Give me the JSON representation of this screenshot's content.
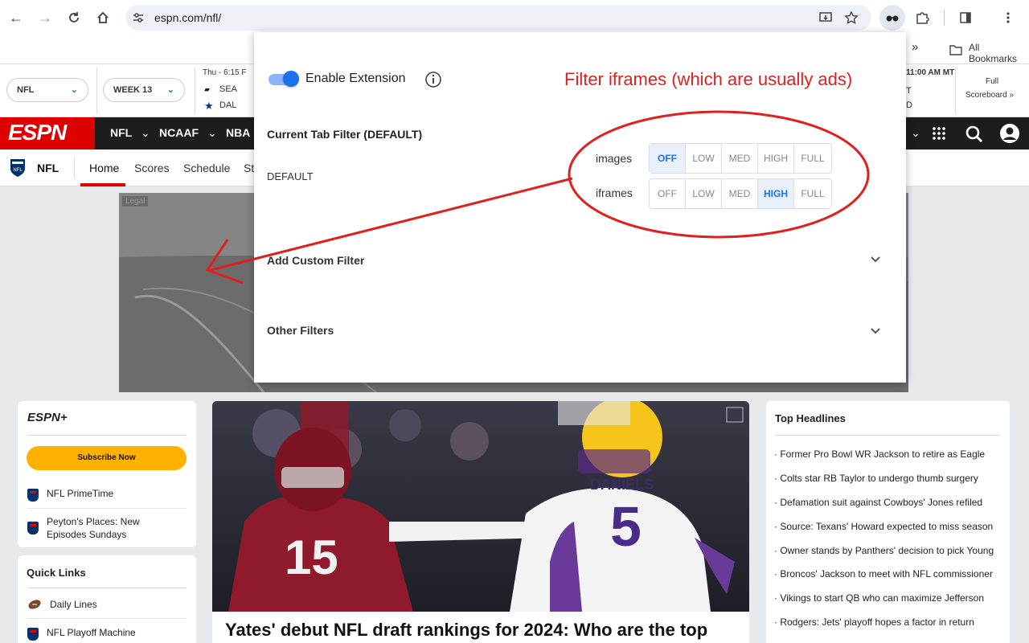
{
  "browser": {
    "url": "espn.com/nfl/",
    "bookmarks_overflow": "»",
    "all_bookmarks_label": "All Bookmarks"
  },
  "scorebar": {
    "league_select": "NFL",
    "week_select": "WEEK 13",
    "game": {
      "time": "Thu - 6:15 F",
      "team1": "SEA",
      "team2": "DAL"
    },
    "right_time": "11:00 AM MT",
    "right_t": "T",
    "right_d": "D",
    "full_scoreboard_line1": "Full",
    "full_scoreboard_line2": "Scoreboard »"
  },
  "espn_nav": {
    "logo": "ESPN",
    "links": [
      "NFL",
      "NCAAF",
      "NBA"
    ]
  },
  "subnav": {
    "league": "NFL",
    "items": [
      "Home",
      "Scores",
      "Schedule",
      "St"
    ]
  },
  "ad": {
    "legal": "Legal"
  },
  "left_card": {
    "brand": "ESPN+",
    "subscribe": "Subscribe Now",
    "items": [
      "NFL PrimeTime",
      "Peyton's Places: New Episodes Sundays"
    ]
  },
  "quick_links": {
    "title": "Quick Links",
    "items": [
      "Daily Lines",
      "NFL Playoff Machine"
    ]
  },
  "hero": {
    "title": "Yates' debut NFL draft rankings for 2024: Who are the top",
    "jersey_name": "DANIELS",
    "jersey_number": "5",
    "alt_number": "15"
  },
  "headlines": {
    "title": "Top Headlines",
    "items": [
      "Former Pro Bowl WR Jackson to retire as Eagle",
      "Colts star RB Taylor to undergo thumb surgery",
      "Defamation suit against Cowboys' Jones refiled",
      "Source: Texans' Howard expected to miss season",
      "Owner stands by Panthers' decision to pick Young",
      "Broncos' Jackson to meet with NFL commissioner",
      "Vikings to start QB who can maximize Jefferson",
      "Rodgers: Jets' playoff hopes a factor in return"
    ]
  },
  "popup": {
    "enable_label": "Enable Extension",
    "current_filter_title": "Current Tab Filter (DEFAULT)",
    "filter_name": "DEFAULT",
    "levels": [
      "OFF",
      "LOW",
      "MED",
      "HIGH",
      "FULL"
    ],
    "images_label": "images",
    "images_active": "OFF",
    "iframes_label": "iframes",
    "iframes_active": "HIGH",
    "add_custom_filter": "Add Custom Filter",
    "other_filters": "Other Filters",
    "annotation": "Filter iframes (which are usually ads)",
    "enabled": true
  },
  "colors": {
    "espn_red": "#d00000",
    "annotation_red": "#e0201e",
    "active_blue": "#1a73e8"
  }
}
